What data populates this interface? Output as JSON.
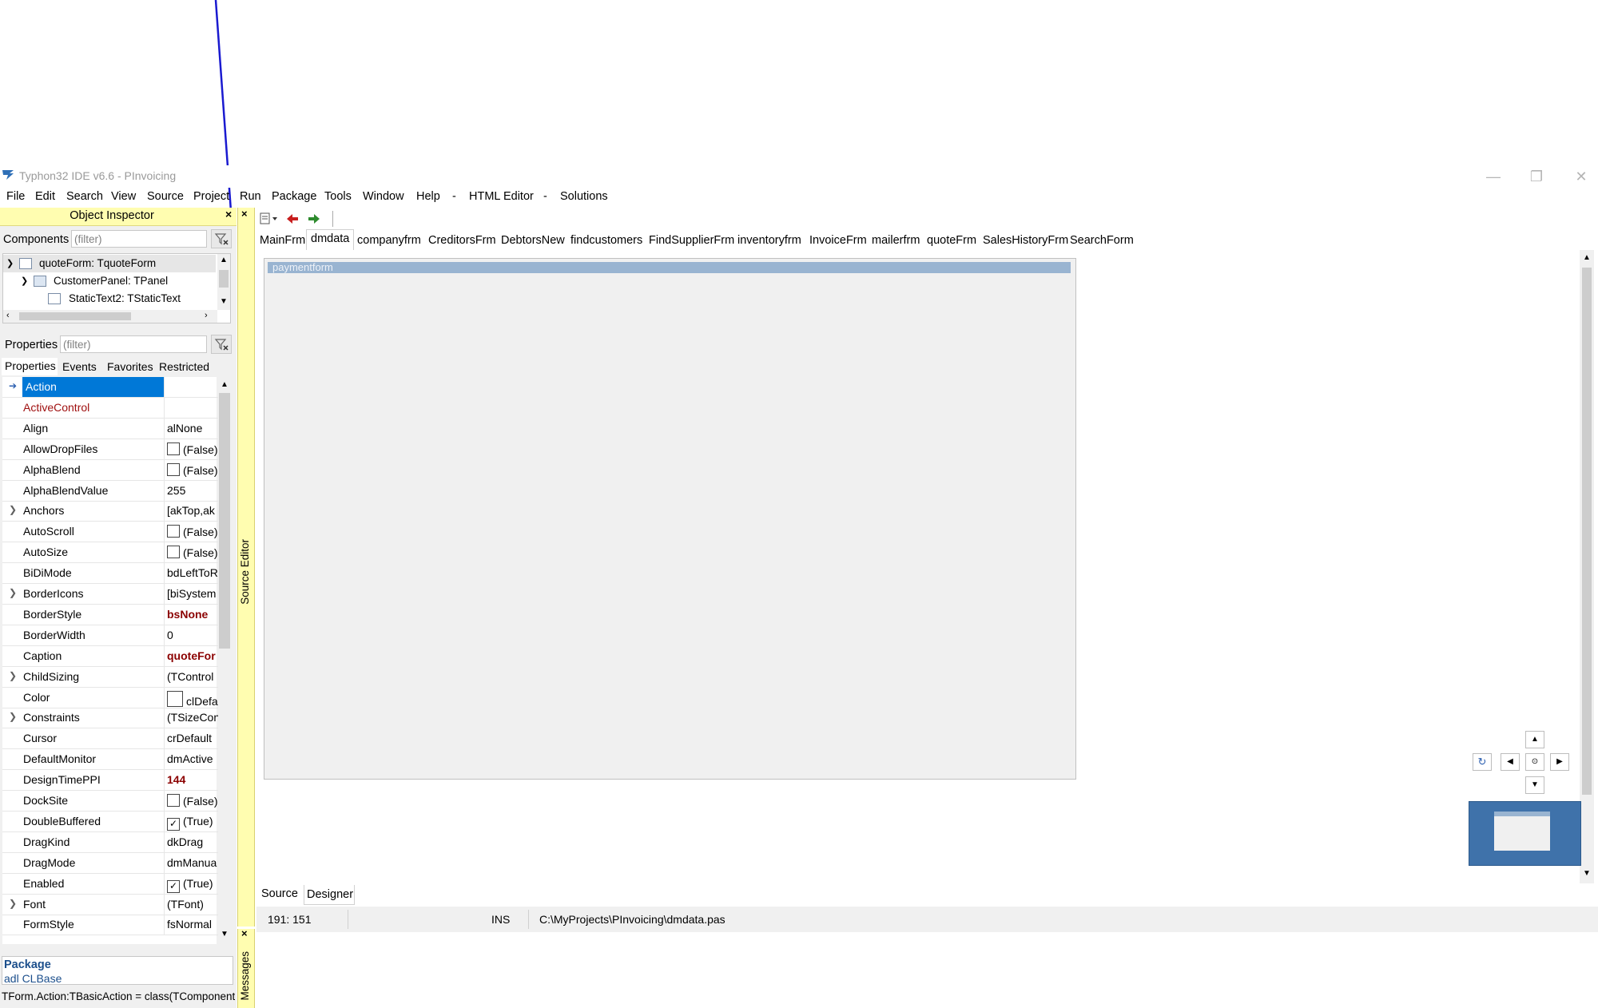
{
  "window": {
    "title": "Typhon32 IDE v6.6 - PInvoicing",
    "minimize": "—",
    "restore": "❐",
    "close": "✕"
  },
  "menu": [
    "File",
    "Edit",
    "Search",
    "View",
    "Source",
    "Project",
    "Run",
    "Package",
    "Tools",
    "Window",
    "Help",
    "-",
    "HTML Editor",
    "-",
    "Solutions"
  ],
  "object_inspector": {
    "title": "Object Inspector",
    "close": "×",
    "components_label": "Components",
    "components_filter": "(filter)",
    "tree": [
      {
        "label": "quoteForm: TquoteForm"
      },
      {
        "label": "CustomerPanel: TPanel"
      },
      {
        "label": "StaticText2: TStaticText"
      }
    ],
    "properties_label": "Properties",
    "properties_filter": "(filter)",
    "tabs": [
      "Properties",
      "Events",
      "Favorites",
      "Restricted"
    ],
    "properties": [
      {
        "name": "Action",
        "value": "",
        "selected": true
      },
      {
        "name": "ActiveControl",
        "value": "",
        "red": true
      },
      {
        "name": "Align",
        "value": "alNone"
      },
      {
        "name": "AllowDropFiles",
        "value": "(False)",
        "check": "off"
      },
      {
        "name": "AlphaBlend",
        "value": "(False)",
        "check": "off"
      },
      {
        "name": "AlphaBlendValue",
        "value": "255"
      },
      {
        "name": "Anchors",
        "value": "[akTop,ak",
        "expand": true
      },
      {
        "name": "AutoScroll",
        "value": "(False)",
        "check": "off"
      },
      {
        "name": "AutoSize",
        "value": "(False)",
        "check": "off"
      },
      {
        "name": "BiDiMode",
        "value": "bdLeftToR"
      },
      {
        "name": "BorderIcons",
        "value": "[biSystem",
        "expand": true
      },
      {
        "name": "BorderStyle",
        "value": "bsNone",
        "bold": true
      },
      {
        "name": "BorderWidth",
        "value": "0"
      },
      {
        "name": "Caption",
        "value": "quoteFor",
        "bold": true
      },
      {
        "name": "ChildSizing",
        "value": "(TControl",
        "expand": true
      },
      {
        "name": "Color",
        "value": "clDefa",
        "swatch": true
      },
      {
        "name": "Constraints",
        "value": "(TSizeCon",
        "expand": true
      },
      {
        "name": "Cursor",
        "value": "crDefault"
      },
      {
        "name": "DefaultMonitor",
        "value": "dmActive"
      },
      {
        "name": "DesignTimePPI",
        "value": "144",
        "bold": true
      },
      {
        "name": "DockSite",
        "value": "(False)",
        "check": "off"
      },
      {
        "name": "DoubleBuffered",
        "value": "(True)",
        "check": "on"
      },
      {
        "name": "DragKind",
        "value": "dkDrag"
      },
      {
        "name": "DragMode",
        "value": "dmManua"
      },
      {
        "name": "Enabled",
        "value": "(True)",
        "check": "on"
      },
      {
        "name": "Font",
        "value": "(TFont)",
        "expand": true
      },
      {
        "name": "FormStyle",
        "value": "fsNormal"
      }
    ],
    "info_title": "Package",
    "info_sub": "adl CLBase",
    "hint": "TForm.Action:TBasicAction = class(TComponent"
  },
  "side": {
    "source_editor": "Source Editor",
    "messages": "Messages"
  },
  "editor_tabs": [
    "MainFrm",
    "dmdata",
    "companyfrm",
    "CreditorsFrm",
    "DebtorsNew",
    "findcustomers",
    "FindSupplierFrm",
    "inventoryfrm",
    "InvoiceFrm",
    "mailerfrm",
    "quoteFrm",
    "SalesHistoryFrm",
    "SearchForm"
  ],
  "active_tab": "dmdata",
  "form_caption": "paymentform",
  "bottom_tabs": [
    "Source",
    "Designer"
  ],
  "status": {
    "position": "191: 151",
    "mode": "INS",
    "file": "C:\\MyProjects\\PInvoicing\\dmdata.pas"
  },
  "colors": {
    "accent_yellow": "#fffdb0",
    "selection_blue": "#0078d7",
    "form_title": "#99b4d1",
    "property_red": "#8b0000"
  }
}
